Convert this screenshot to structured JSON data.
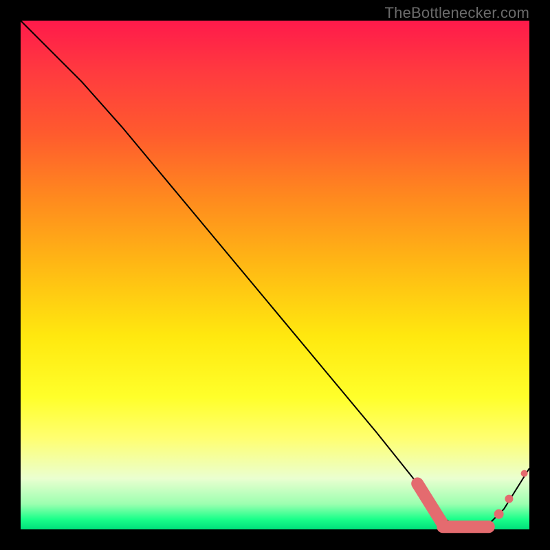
{
  "attribution": "TheBottlenecker.com",
  "chart_data": {
    "type": "line",
    "title": "",
    "xlabel": "",
    "ylabel": "",
    "xlim": [
      0,
      100
    ],
    "ylim": [
      0,
      100
    ],
    "series": [
      {
        "name": "curve",
        "x": [
          0,
          6,
          12,
          20,
          30,
          40,
          50,
          60,
          70,
          78,
          82,
          85,
          88,
          90,
          92,
          95,
          100
        ],
        "y": [
          100,
          94,
          88,
          79,
          67,
          55,
          43,
          31,
          19,
          9,
          3,
          1,
          0,
          0,
          1,
          4,
          12
        ]
      }
    ],
    "markers": [
      {
        "name": "left-cap-start",
        "x": 78,
        "y": 9
      },
      {
        "name": "left-cap-end",
        "x": 83,
        "y": 1
      },
      {
        "name": "flat-start",
        "x": 83,
        "y": 0.5
      },
      {
        "name": "flat-end",
        "x": 92,
        "y": 0.5
      },
      {
        "name": "dot-1",
        "x": 94,
        "y": 3
      },
      {
        "name": "dot-2",
        "x": 96,
        "y": 6
      },
      {
        "name": "dot-3",
        "x": 99,
        "y": 11
      }
    ]
  }
}
